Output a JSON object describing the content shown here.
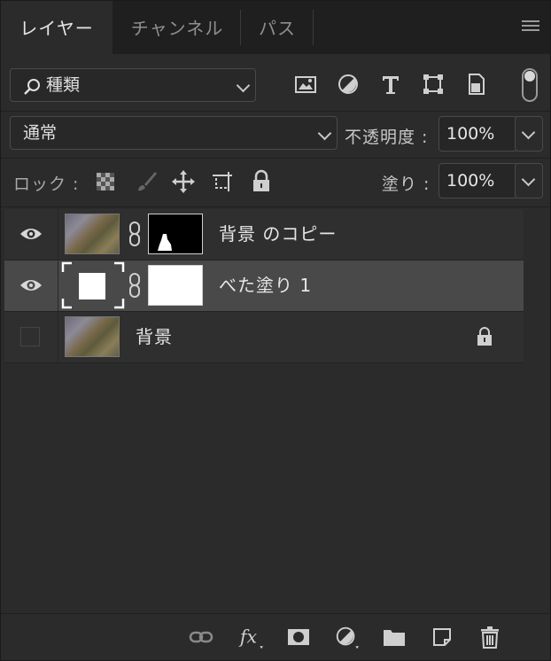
{
  "tabs": [
    {
      "label": "レイヤー",
      "active": true
    },
    {
      "label": "チャンネル",
      "active": false
    },
    {
      "label": "パス",
      "active": false
    }
  ],
  "filter": {
    "kind_label": "種類"
  },
  "blend": {
    "mode": "通常",
    "opacity_label": "不透明度 :",
    "opacity_value": "100%"
  },
  "lock": {
    "label": "ロック :",
    "fill_label": "塗り :",
    "fill_value": "100%"
  },
  "layers": [
    {
      "name": "背景 のコピー",
      "visible": true,
      "selected": false
    },
    {
      "name": "べた塗り 1",
      "visible": true,
      "selected": true
    },
    {
      "name": "背景",
      "visible": false,
      "selected": false,
      "locked": true
    }
  ],
  "colors": {
    "panel": "#2b2b2b",
    "tabbar": "#1f1f1f",
    "selected": "#494949",
    "text": "#e6e6e6"
  },
  "footer_icons": [
    "link-icon",
    "fx-icon",
    "mask-icon",
    "adjustment-icon",
    "folder-icon",
    "new-layer-icon",
    "trash-icon"
  ]
}
